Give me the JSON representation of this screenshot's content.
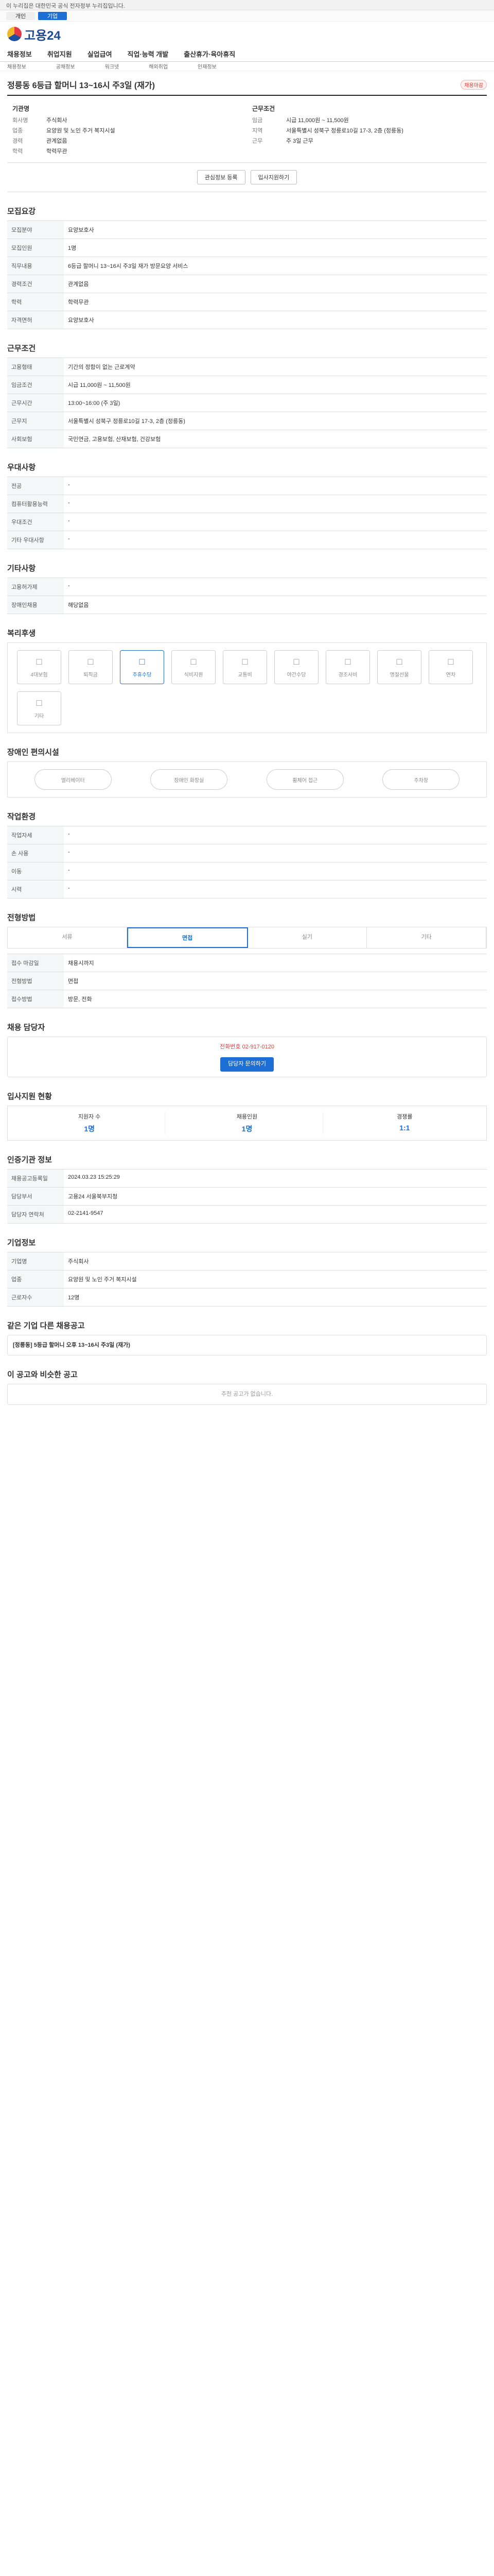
{
  "gov_bar": "이 누리집은 대한민국 공식 전자정부 누리집입니다.",
  "util": [
    "개인",
    "기업"
  ],
  "brand": "고용24",
  "gnb": [
    "채용정보",
    "취업지원",
    "실업급여",
    "직업·능력 개발",
    "출산휴가·육아휴직"
  ],
  "sub": [
    "채용정보",
    "공채정보",
    "워크넷",
    "해외취업",
    "인재정보"
  ],
  "job": {
    "title": "정릉동 6등급 할머니 13~16시 주3일 (재가)",
    "tag": "채용마감",
    "company": "기관명",
    "company_name": "주식회사",
    "biz": "요양원 및 노인 주거 복지시설",
    "cond": "근무조건",
    "wage": "시급 11,000원 ~ 11,500원",
    "place": "서울특별시 성북구 정릉로10길 17-3, 2층 (정릉동)",
    "hours": "주 3일 근무",
    "exp": "관계없음",
    "edu": "학력무관",
    "btn1": "관심정보 등록",
    "btn2": "입사지원하기"
  },
  "sec_recruit": "모집요강",
  "recruit_rows": [
    [
      "모집분야",
      "요양보호사"
    ],
    [
      "모집인원",
      "1명"
    ],
    [
      "직무내용",
      "6등급 할머니 13~16시 주3일 재가 방문요양 서비스"
    ],
    [
      "경력조건",
      "관계없음"
    ],
    [
      "학력",
      "학력무관"
    ],
    [
      "자격면허",
      "요양보호사"
    ]
  ],
  "sec_cond": "근무조건",
  "cond_rows": [
    [
      "고용형태",
      "기간의 정함이 없는 근로계약"
    ],
    [
      "임금조건",
      "시급 11,000원 ~ 11,500원"
    ],
    [
      "근무시간",
      "13:00~16:00 (주 3일)"
    ],
    [
      "근무지",
      "서울특별시 성북구 정릉로10길 17-3, 2층 (정릉동)"
    ],
    [
      "사회보험",
      "국민연금, 고용보험, 산재보험, 건강보험"
    ]
  ],
  "sec_welfare": "우대사항",
  "welfare_rows": [
    [
      "전공",
      "-"
    ],
    [
      "컴퓨터활용능력",
      "-"
    ],
    [
      "우대조건",
      "-"
    ],
    [
      "기타 우대사항",
      "-"
    ]
  ],
  "sec_other": "기타사항",
  "other_rows": [
    [
      "고용허가제",
      "-"
    ],
    [
      "장애인채용",
      "해당없음"
    ]
  ],
  "sec_benefit": "복리후생",
  "benefits": [
    "4대보험",
    "퇴직금",
    "주휴수당",
    "식비지원",
    "교통비",
    "야간수당",
    "경조사비",
    "명절선물",
    "연차",
    "기타"
  ],
  "sec_disab": "장애인 편의시설",
  "disab": [
    "엘리베이터",
    "장애인 화장실",
    "휠체어 접근",
    "주차장"
  ],
  "sec_env": "작업환경",
  "env_rows": [
    [
      "작업자세",
      "-"
    ],
    [
      "손 사용",
      "-"
    ],
    [
      "이동",
      "-"
    ],
    [
      "시력",
      "-"
    ]
  ],
  "sec_apply": "전형방법",
  "tabs": [
    "서류",
    "면접",
    "실기",
    "기타"
  ],
  "apply_rows": [
    [
      "접수 마감일",
      "채용시까지"
    ],
    [
      "전형방법",
      "면접"
    ],
    [
      "접수방법",
      "방문, 전화"
    ]
  ],
  "sec_contact": "채용 담당자",
  "contact": "전화번호 02-917-0120",
  "contact_btn": "담당자 문의하기",
  "sec_stat": "입사지원 현황",
  "stats": [
    [
      "지원자 수",
      "1명"
    ],
    [
      "채용인원",
      "1명"
    ],
    [
      "경쟁률",
      "1:1"
    ]
  ],
  "sec_info": "인증기관 정보",
  "info_rows": [
    [
      "채용공고등록일",
      "2024.03.23 15:25:29"
    ],
    [
      "담당부서",
      "고용24 서울북부지청"
    ],
    [
      "담당자 연락처",
      "02-2141-9547"
    ]
  ],
  "sec_company": "기업정보",
  "company_rows": [
    [
      "기업명",
      "주식회사"
    ],
    [
      "업종",
      "요양원 및 노인 주거 복지시설"
    ],
    [
      "근로자수",
      "12명"
    ]
  ],
  "sec_same": "같은 기업 다른 채용공고",
  "same_title": "[정릉동] 5등급 할머니 오후 13~16시 주3일 (재가)",
  "sec_rec": "이 공고와 비슷한 공고",
  "rec_empty": "추천 공고가 없습니다."
}
